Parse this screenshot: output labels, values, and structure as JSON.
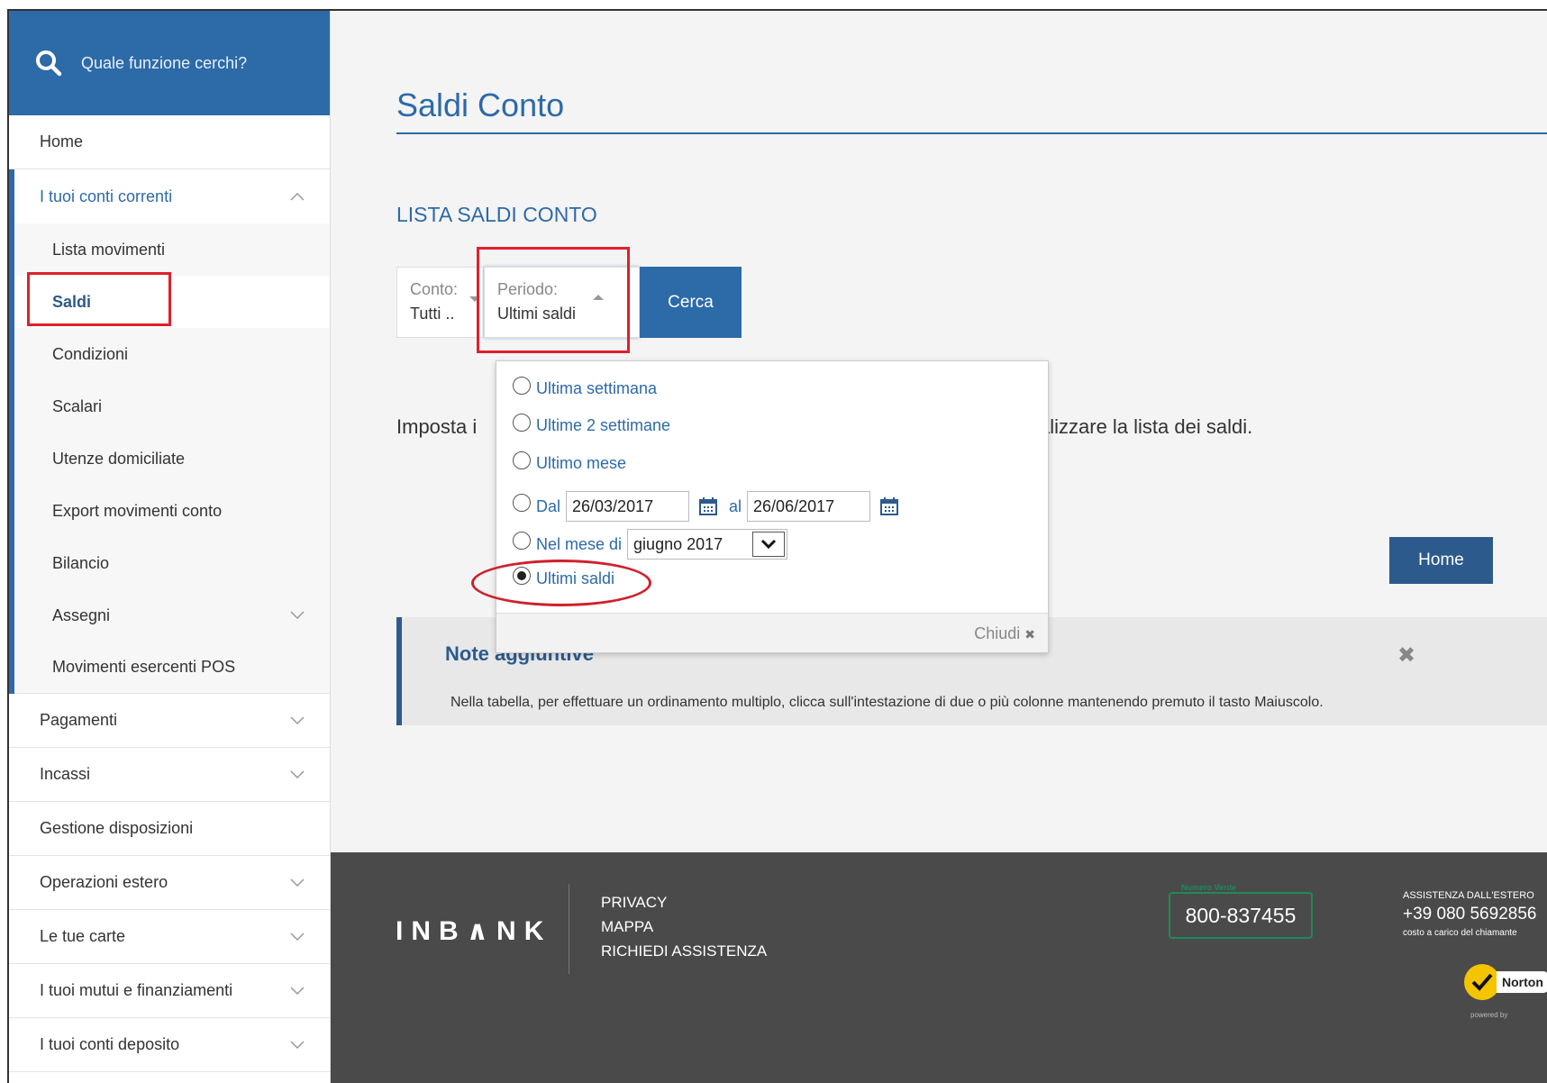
{
  "search": {
    "placeholder": "Quale funzione cerchi?"
  },
  "sidebar": {
    "items": [
      {
        "label": "Home"
      },
      {
        "label": "I tuoi conti correnti"
      },
      {
        "label": "Pagamenti"
      },
      {
        "label": "Incassi"
      },
      {
        "label": "Gestione disposizioni"
      },
      {
        "label": "Operazioni estero"
      },
      {
        "label": "Le tue carte"
      },
      {
        "label": "I tuoi mutui e finanziamenti"
      },
      {
        "label": "I tuoi conti deposito"
      }
    ],
    "subitems": [
      {
        "label": "Lista movimenti"
      },
      {
        "label": "Saldi"
      },
      {
        "label": "Condizioni"
      },
      {
        "label": "Scalari"
      },
      {
        "label": "Utenze domiciliate"
      },
      {
        "label": "Export movimenti conto"
      },
      {
        "label": "Bilancio"
      },
      {
        "label": "Assegni"
      },
      {
        "label": "Movimenti esercenti POS"
      }
    ]
  },
  "main": {
    "title": "Saldi Conto",
    "section_title": "LISTA SALDI CONTO",
    "filter_conto": {
      "label": "Conto:",
      "value": "Tutti .."
    },
    "filter_periodo": {
      "label": "Periodo:",
      "value": "Ultimi saldi"
    },
    "cerca_label": "Cerca",
    "info_left": "Imposta i",
    "info_right": "alizzare la lista dei saldi.",
    "home_label": "Home",
    "note": {
      "title": "Note aggiuntive",
      "text": "Nella tabella, per effettuare un ordinamento multiplo, clicca sull'intestazione di due o più colonne mantenendo premuto il tasto Maiuscolo."
    }
  },
  "dropdown": {
    "options": [
      {
        "label": "Ultima settimana",
        "checked": false
      },
      {
        "label": "Ultime 2 settimane",
        "checked": false
      },
      {
        "label": "Ultimo mese",
        "checked": false
      },
      {
        "label": "Dal",
        "checked": false
      },
      {
        "label": "Nel mese di",
        "checked": false
      },
      {
        "label": "Ultimi saldi",
        "checked": true
      }
    ],
    "date_from": "26/03/2017",
    "date_to_label": "al",
    "date_to": "26/06/2017",
    "month_value": "giugno 2017",
    "close_label": "Chiudi"
  },
  "footer": {
    "logo": "INB∧NK",
    "links": [
      "PRIVACY",
      "MAPPA",
      "RICHIEDI ASSISTENZA"
    ],
    "numero_verde_label": "Numero Verde",
    "numero_verde": "800-837455",
    "assist_title": "ASSISTENZA DALL'ESTERO",
    "assist_phone": "+39 080 5692856",
    "assist_note": "costo a carico del chiamante",
    "norton_label": "Norton",
    "norton_sub": "powered by"
  },
  "colors": {
    "primary": "#2d6aa8",
    "dark_primary": "#2d5a8c",
    "highlight": "#e0202b",
    "footer_bg": "#4a4a4a"
  }
}
